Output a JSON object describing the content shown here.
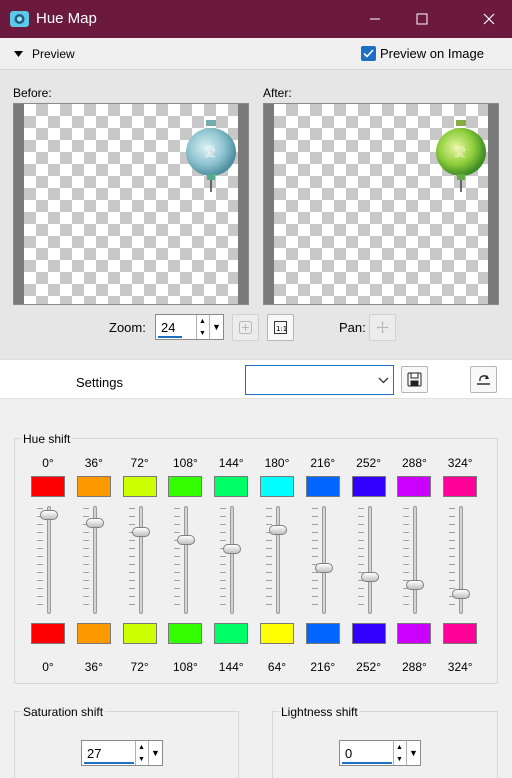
{
  "window": {
    "title": "Hue Map"
  },
  "preview": {
    "toggle_label": "Preview",
    "preview_on_image_label": "Preview on Image",
    "preview_on_image_checked": true
  },
  "before": {
    "label": "Before:"
  },
  "after": {
    "label": "After:"
  },
  "zoom": {
    "label": "Zoom:",
    "value": "24"
  },
  "pan": {
    "label": "Pan:"
  },
  "settings": {
    "label": "Settings",
    "value": ""
  },
  "hue_shift": {
    "title": "Hue shift",
    "bands": [
      {
        "top_label": "0°",
        "top_color": "#ff0000",
        "bottom_color": "#ff0000",
        "bottom_label": "0°",
        "level": 0.96
      },
      {
        "top_label": "36°",
        "top_color": "#ff9900",
        "bottom_color": "#ff9900",
        "bottom_label": "36°",
        "level": 0.88
      },
      {
        "top_label": "72°",
        "top_color": "#ccff00",
        "bottom_color": "#ccff00",
        "bottom_label": "72°",
        "level": 0.79
      },
      {
        "top_label": "108°",
        "top_color": "#33ff00",
        "bottom_color": "#33ff00",
        "bottom_label": "108°",
        "level": 0.7
      },
      {
        "top_label": "144°",
        "top_color": "#00ff66",
        "bottom_color": "#00ff66",
        "bottom_label": "144°",
        "level": 0.61
      },
      {
        "top_label": "180°",
        "top_color": "#00ffff",
        "bottom_color": "#ffff00",
        "bottom_label": "64°",
        "level": 0.81
      },
      {
        "top_label": "216°",
        "top_color": "#0066ff",
        "bottom_color": "#0066ff",
        "bottom_label": "216°",
        "level": 0.42
      },
      {
        "top_label": "252°",
        "top_color": "#3300ff",
        "bottom_color": "#3300ff",
        "bottom_label": "252°",
        "level": 0.33
      },
      {
        "top_label": "288°",
        "top_color": "#cc00ff",
        "bottom_color": "#cc00ff",
        "bottom_label": "288°",
        "level": 0.24
      },
      {
        "top_label": "324°",
        "top_color": "#ff0099",
        "bottom_color": "#ff0099",
        "bottom_label": "324°",
        "level": 0.15
      }
    ]
  },
  "saturation_shift": {
    "title": "Saturation shift",
    "value": "27"
  },
  "lightness_shift": {
    "title": "Lightness shift",
    "value": "0"
  },
  "colors": {
    "titlebar": "#6b1a3e",
    "accent": "#1b6fc4"
  }
}
